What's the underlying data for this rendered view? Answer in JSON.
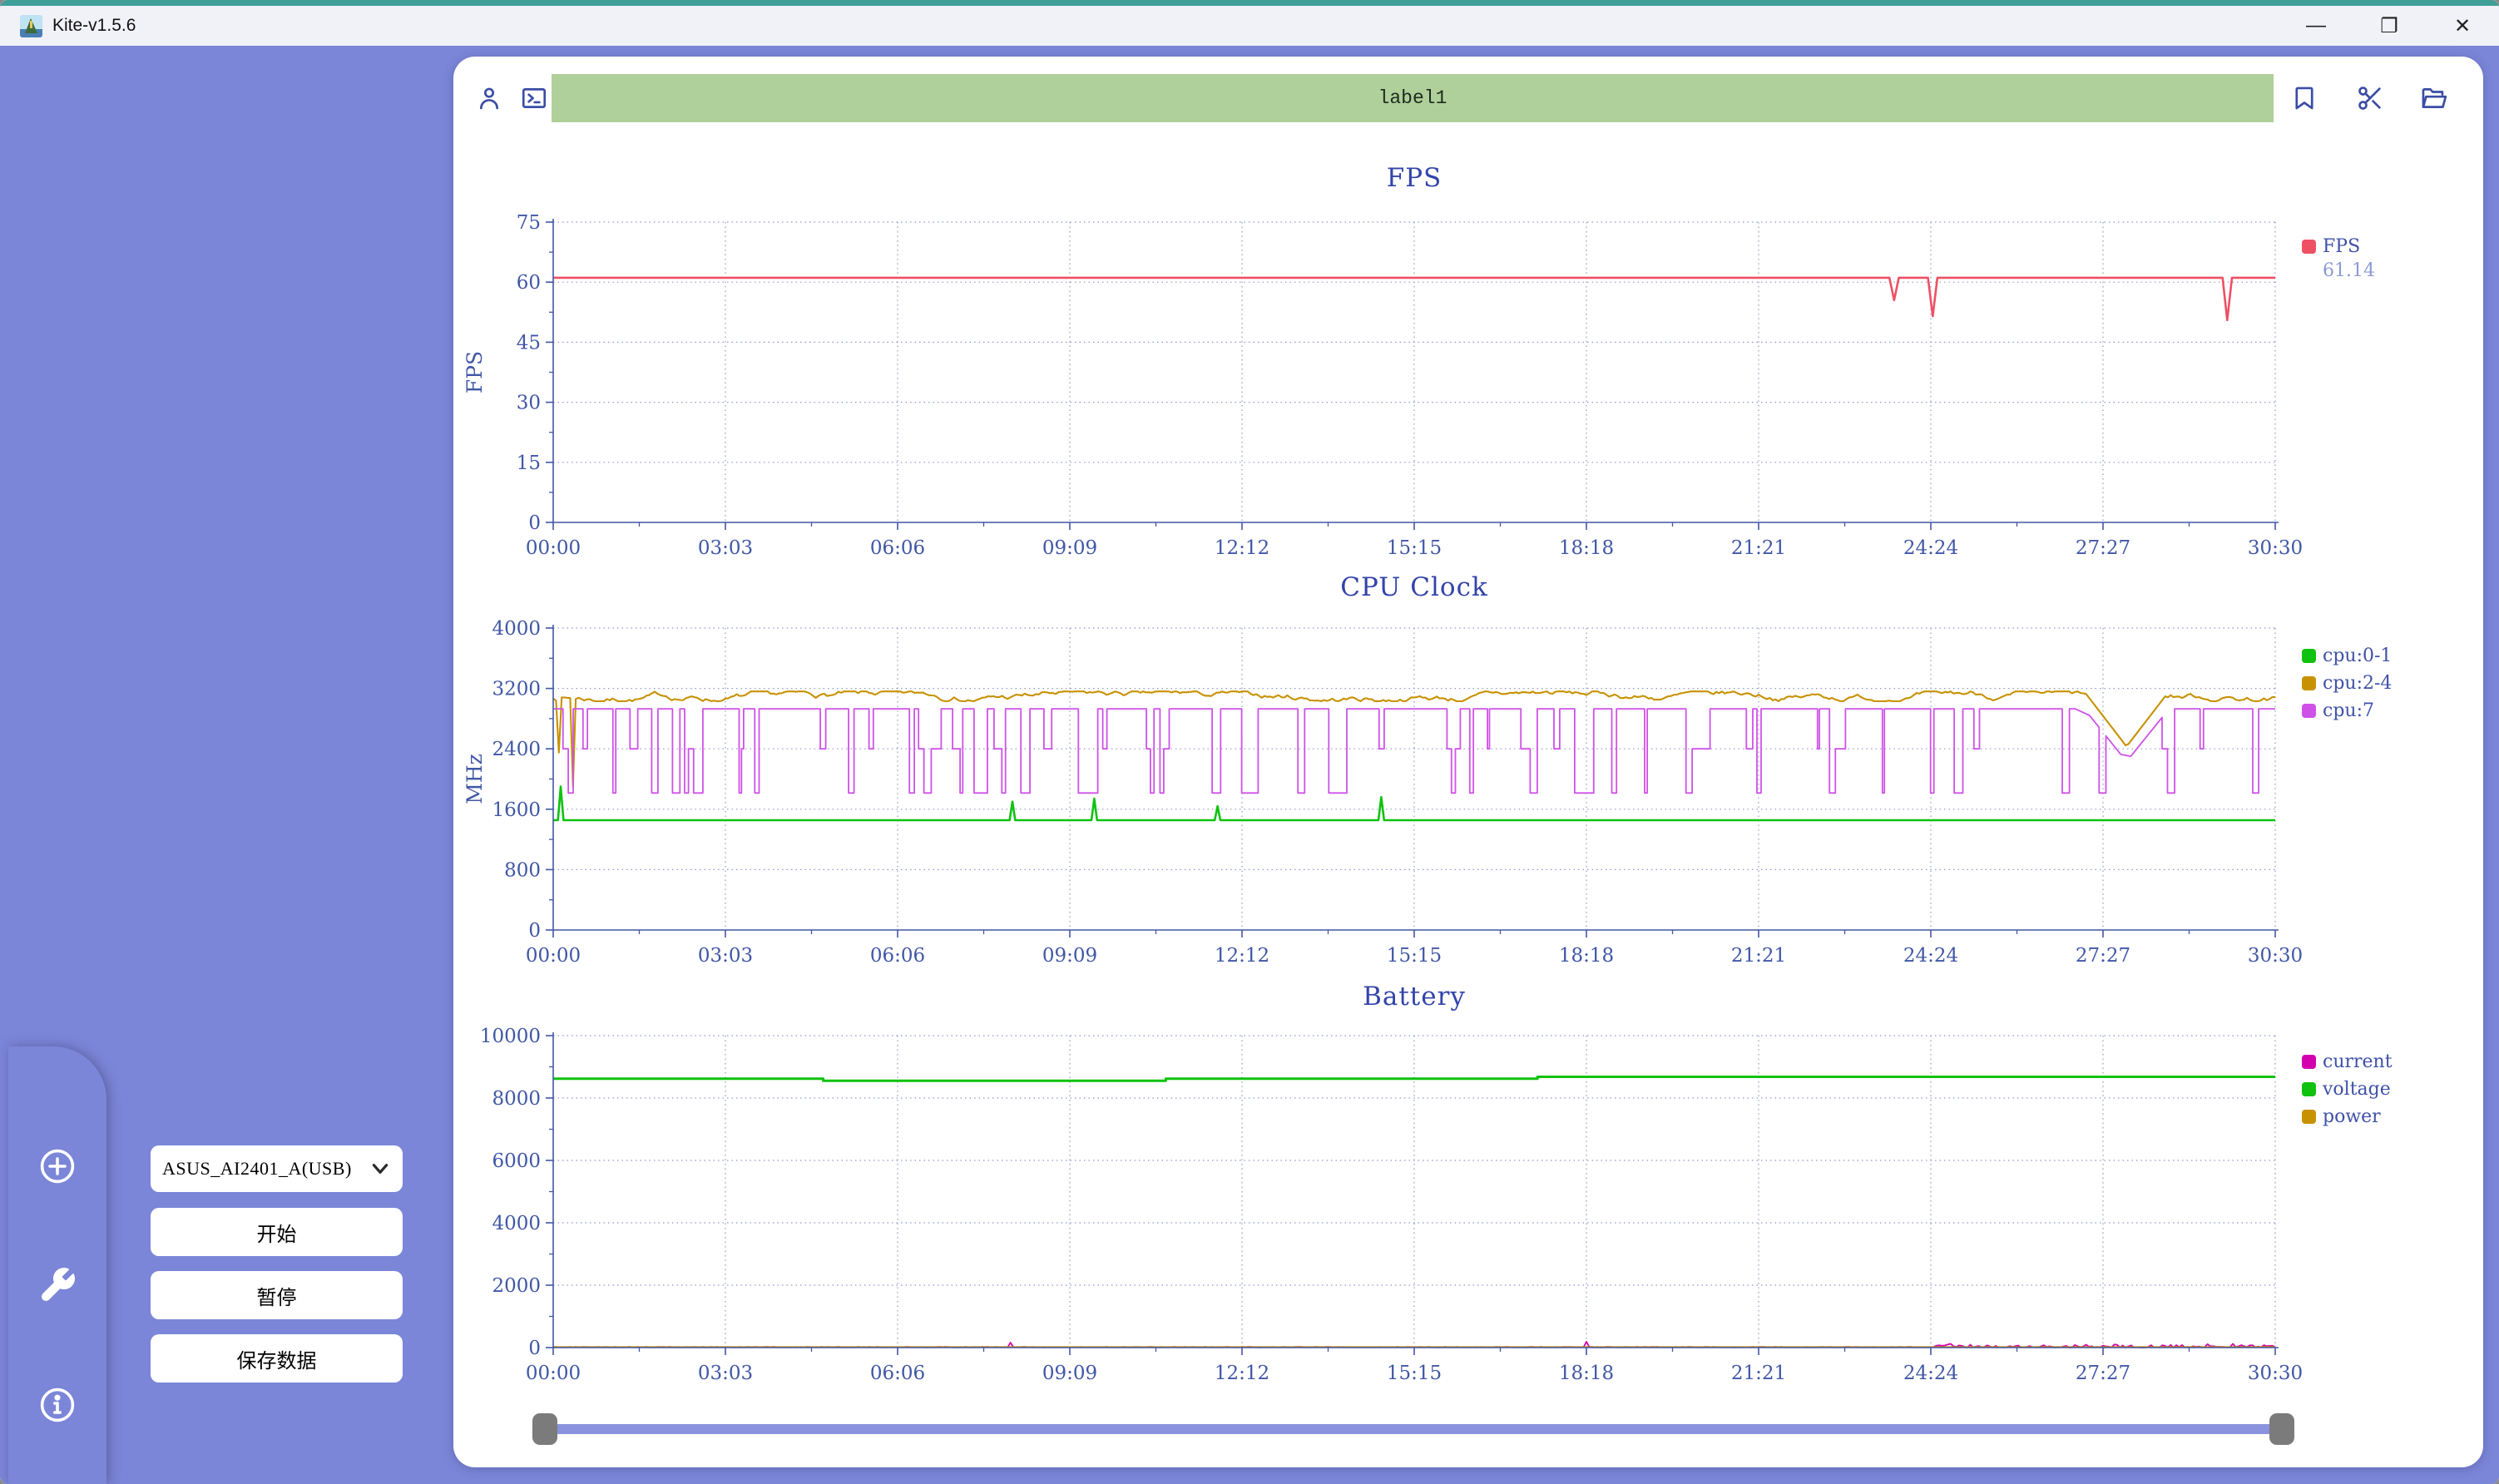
{
  "window": {
    "title": "Kite-v1.5.6",
    "controls": {
      "minimize": "—",
      "maximize": "❐",
      "close": "✕"
    }
  },
  "toolbar": {
    "left_icons": [
      "user-icon",
      "terminal-icon"
    ],
    "label_field": "label1",
    "right_icons": [
      "bookmark-icon",
      "scissors-icon",
      "folder-icon"
    ]
  },
  "sidebar": {
    "device_select": {
      "value": "ASUS_AI2401_A(USB)"
    },
    "buttons": [
      {
        "label": "开始"
      },
      {
        "label": "暂停"
      },
      {
        "label": "保存数据"
      }
    ],
    "dock_icons": [
      "add-icon",
      "wrench-icon",
      "info-icon"
    ]
  },
  "colors": {
    "accent_periwinkle": "#7b86d8",
    "titlebar_bg": "#f1f1f8",
    "top_strip_teal": "#3f9f99",
    "toolbar_green": "#afd09a",
    "icon_blue": "#3b4da5",
    "axis_blue": "#4157a6",
    "grid_dotted": "#8f99c9",
    "fps_red": "#ee5064",
    "cpu_green": "#0fc20f",
    "cpu_gold": "#c79102",
    "cpu_magenta": "#cf52e8",
    "battery_magenta": "#d400b0",
    "slider_fill": "#8a93dd",
    "slider_handle": "#7b7b7b"
  },
  "chart_data": [
    {
      "type": "line",
      "title": "FPS",
      "ylabel": "FPS",
      "ylim": [
        0,
        75
      ],
      "yticks": [
        0,
        15,
        30,
        45,
        60,
        75
      ],
      "x_duration_seconds": 1830,
      "xtick_labels": [
        "00:00",
        "03:03",
        "06:06",
        "09:09",
        "12:12",
        "15:15",
        "18:18",
        "21:21",
        "24:24",
        "27:27",
        "30:30"
      ],
      "grid": "dotted",
      "legend_position": "right",
      "series": [
        {
          "name": "FPS",
          "color": "#ee5064",
          "value_label": "61.14",
          "gen": {
            "kind": "baseline-dips",
            "baseline": 61.1,
            "dip_halfwidth_s": 5,
            "dips": [
              [
                1425,
                55.5
              ],
              [
                1466,
                51.5
              ],
              [
                1779,
                50.5
              ]
            ]
          }
        }
      ]
    },
    {
      "type": "line",
      "title": "CPU Clock",
      "ylabel": "MHz",
      "ylim": [
        0,
        4000
      ],
      "yticks": [
        0,
        800,
        1600,
        2400,
        3200,
        4000
      ],
      "x_duration_seconds": 1830,
      "xtick_labels": [
        "00:00",
        "03:03",
        "06:06",
        "09:09",
        "12:12",
        "15:15",
        "18:18",
        "21:21",
        "24:24",
        "27:27",
        "30:30"
      ],
      "grid": "dotted",
      "legend_position": "right",
      "series": [
        {
          "name": "cpu:0-1",
          "color": "#0fc20f",
          "gen": {
            "kind": "baseline-spikes",
            "baseline": 1455,
            "spikes": [
              [
                8,
                1900
              ],
              [
                488,
                1700
              ],
              [
                575,
                1740
              ],
              [
                706,
                1640
              ],
              [
                880,
                1760
              ]
            ]
          }
        },
        {
          "name": "cpu:2-4",
          "color": "#c79102",
          "gen": {
            "kind": "noisy-band",
            "lo": 3030,
            "hi": 3160,
            "seed": 7,
            "drops": [
              [
                6,
                2350
              ],
              [
                22,
                1900
              ]
            ],
            "dip": [
              1672,
              2430,
              45
            ]
          }
        },
        {
          "name": "cpu:7",
          "color": "#cf52e8",
          "gen": {
            "kind": "telegraph",
            "levels": [
              2930,
              2400,
              1815
            ],
            "probs": [
              0.52,
              0.16,
              0.32
            ],
            "seed": 11,
            "dip": [
              1672,
              2230,
              45
            ]
          }
        }
      ]
    },
    {
      "type": "line",
      "title": "Battery",
      "ylabel": null,
      "ylim": [
        0,
        10000
      ],
      "yticks": [
        0,
        2000,
        4000,
        6000,
        8000,
        10000
      ],
      "x_duration_seconds": 1830,
      "xtick_labels": [
        "00:00",
        "03:03",
        "06:06",
        "09:09",
        "12:12",
        "15:15",
        "18:18",
        "21:21",
        "24:24",
        "27:27",
        "30:30"
      ],
      "grid": "dotted",
      "legend_position": "right",
      "series": [
        {
          "name": "current",
          "color": "#d400b0",
          "gen": {
            "kind": "baseline-noise",
            "baseline": 18,
            "seed": 5,
            "spikes": [
              [
                487,
                160
              ],
              [
                1099,
                190
              ]
            ],
            "noise_start": 1468,
            "noise_hi": 130
          }
        },
        {
          "name": "voltage",
          "color": "#0fc20f",
          "gen": {
            "kind": "steps",
            "points": [
              [
                0,
                8620
              ],
              [
                287,
                8620
              ],
              [
                287,
                8555
              ],
              [
                651,
                8555
              ],
              [
                651,
                8620
              ],
              [
                1046,
                8620
              ],
              [
                1046,
                8680
              ],
              [
                1830,
                8680
              ]
            ]
          }
        },
        {
          "name": "power",
          "color": "#c79102",
          "gen": {
            "kind": "steps",
            "points": [
              [
                0,
                15
              ],
              [
                1830,
                15
              ]
            ]
          }
        }
      ]
    }
  ]
}
